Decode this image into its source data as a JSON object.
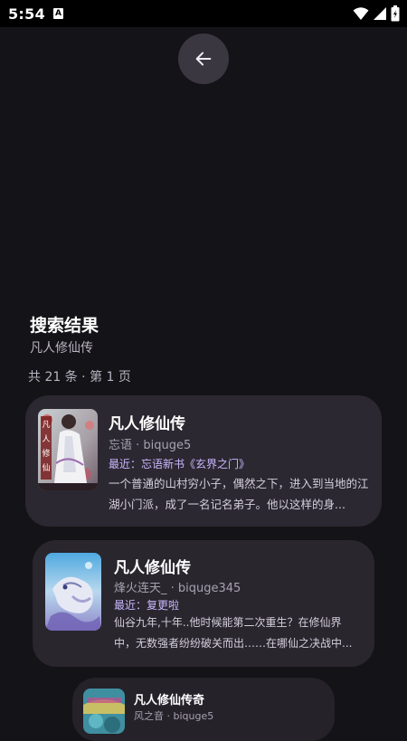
{
  "status_bar": {
    "time": "5:54",
    "notification_badge": "A"
  },
  "back_button": {
    "icon": "arrow-left-icon"
  },
  "results": {
    "title": "搜索结果",
    "query": "凡人修仙传",
    "count_text": "共 21 条 · 第 1 页"
  },
  "books": [
    {
      "title": "凡人修仙传",
      "meta": "忘语 · biquge5",
      "latest": "最近：忘语新书《玄界之门》",
      "intro": "一个普通的山村穷小子，偶然之下，进入到当地的江湖小门派，成了一名记名弟子。他以这样的身..."
    },
    {
      "title": "凡人修仙传",
      "meta": "烽火连天_ · biquge345",
      "latest": "最近：复更啦",
      "intro": "仙谷九年,十年..他时候能第二次重生？在修仙界中，无数强者纷纷破关而出……在哪仙之决战中..."
    },
    {
      "title": "凡人修仙传奇",
      "meta": "风之音 · biquge5"
    }
  ],
  "colors": {
    "background": "#141317",
    "card": "#2b2831",
    "accent": "#c9b8ff"
  }
}
